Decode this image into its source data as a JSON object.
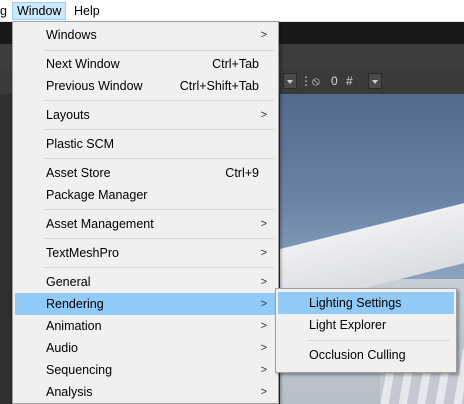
{
  "menubar": {
    "partial_label": "g",
    "window_label": "Window",
    "help_label": "Help"
  },
  "toolbar": {
    "hidden_count": "0"
  },
  "window_menu": {
    "items": [
      {
        "label": "Windows",
        "shortcut": "",
        "submenu": true
      },
      {
        "label": "Next Window",
        "shortcut": "Ctrl+Tab",
        "submenu": false
      },
      {
        "label": "Previous Window",
        "shortcut": "Ctrl+Shift+Tab",
        "submenu": false
      },
      {
        "label": "Layouts",
        "shortcut": "",
        "submenu": true
      },
      {
        "label": "Plastic SCM",
        "shortcut": "",
        "submenu": false
      },
      {
        "label": "Asset Store",
        "shortcut": "Ctrl+9",
        "submenu": false
      },
      {
        "label": "Package Manager",
        "shortcut": "",
        "submenu": false
      },
      {
        "label": "Asset Management",
        "shortcut": "",
        "submenu": true
      },
      {
        "label": "TextMeshPro",
        "shortcut": "",
        "submenu": true
      },
      {
        "label": "General",
        "shortcut": "",
        "submenu": true
      },
      {
        "label": "Rendering",
        "shortcut": "",
        "submenu": true,
        "highlighted": true
      },
      {
        "label": "Animation",
        "shortcut": "",
        "submenu": true
      },
      {
        "label": "Audio",
        "shortcut": "",
        "submenu": true
      },
      {
        "label": "Sequencing",
        "shortcut": "",
        "submenu": true
      },
      {
        "label": "Analysis",
        "shortcut": "",
        "submenu": true
      }
    ]
  },
  "rendering_submenu": {
    "items": [
      {
        "label": "Lighting Settings",
        "highlighted": true
      },
      {
        "label": "Light Explorer"
      },
      {
        "label": "Occlusion Culling"
      }
    ]
  },
  "colors": {
    "highlight": "#91c9f7",
    "menu_bg": "#f0f0f0",
    "active_menubar_bg": "#cce8ff"
  }
}
